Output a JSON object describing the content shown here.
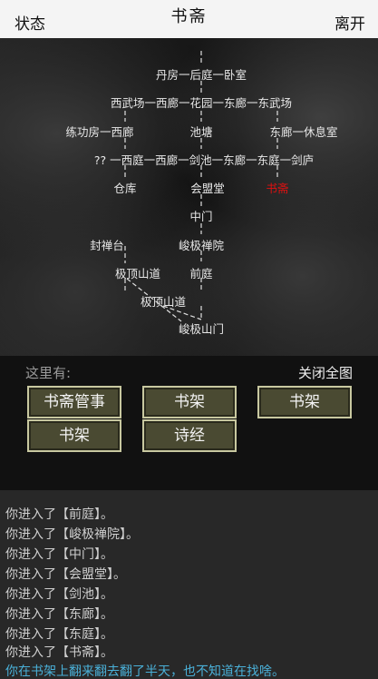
{
  "header": {
    "status_label": "状态",
    "title": "书斋",
    "leave_label": "离开"
  },
  "map_nodes": [
    "丹房一后庭一卧室",
    "西武场一西廊一花园一东廊一东武场",
    "练功房一西廊",
    "池塘",
    "东廊一休息室",
    "?? 一西庭一西廊一剑池一东廊一东庭一剑庐",
    "仓库",
    "会盟堂",
    "书斋",
    "中门",
    "封禅台",
    "峻极禅院",
    "极顶山道",
    "前庭",
    "极顶山道",
    "峻极山门"
  ],
  "current_room": "书斋",
  "here_label": "这里有:",
  "close_map_label": "关闭全图",
  "objects": [
    "书斋管事",
    "书架",
    "书架",
    "书架",
    "诗经"
  ],
  "log": [
    "你进入了【前庭】。",
    "你进入了【峻极禅院】。",
    "你进入了【中门】。",
    "你进入了【会盟堂】。",
    "你进入了【剑池】。",
    "你进入了【东廊】。",
    "你进入了【东庭】。",
    "你进入了【书斋】。",
    "你在书架上翻来翻去翻了半天，也不知道在找啥。"
  ]
}
